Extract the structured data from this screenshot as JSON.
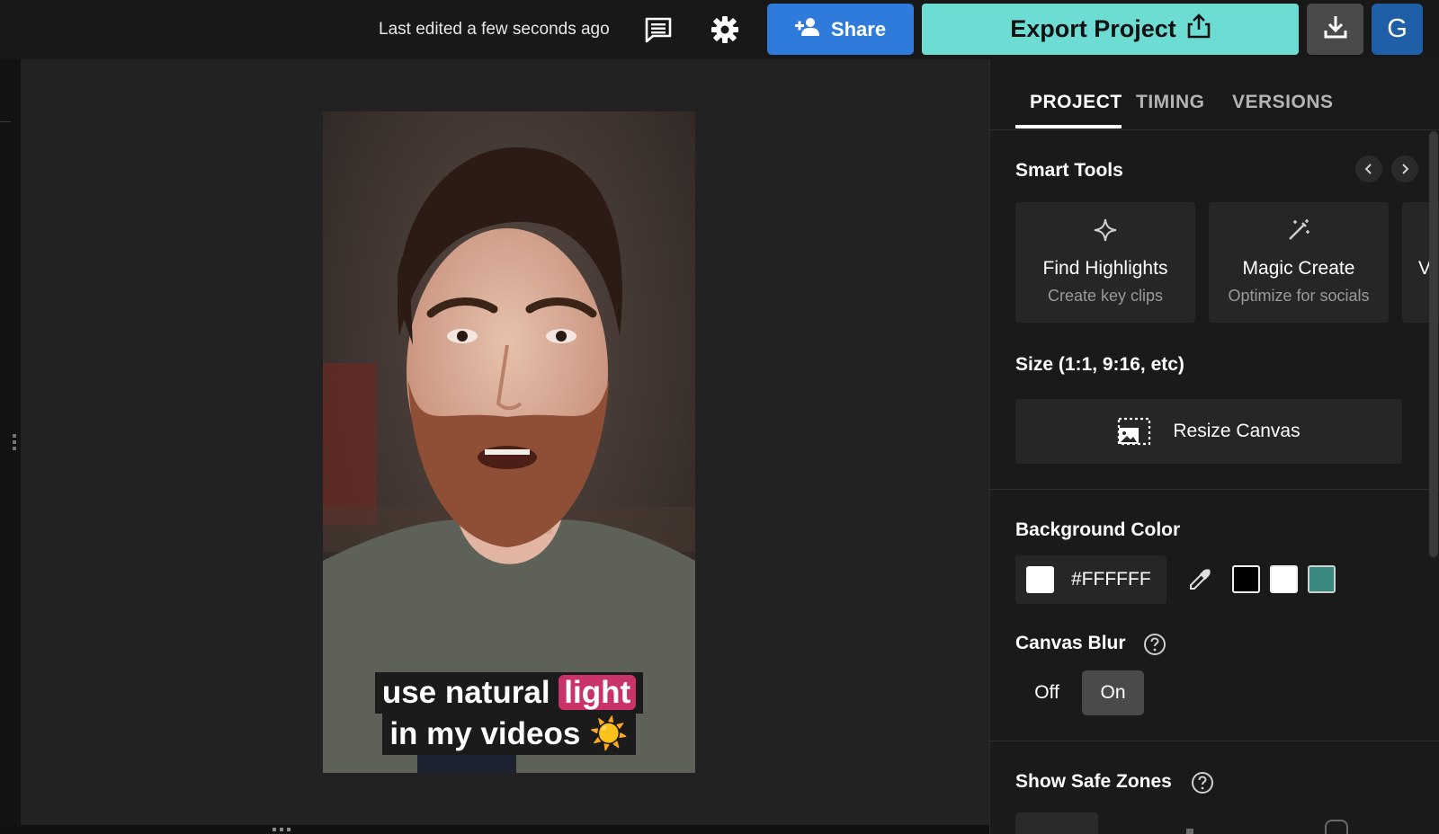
{
  "topbar": {
    "last_edited": "Last edited a few seconds ago",
    "share_label": "Share",
    "export_label": "Export Project",
    "avatar_initial": "G",
    "icons": {
      "comment": "comment-icon",
      "settings": "gear-icon",
      "share": "add-person-icon",
      "export": "share-out-icon",
      "download": "download-icon"
    },
    "colors": {
      "share": "#2e7bdc",
      "export": "#6ddcd3",
      "avatar": "#1f5fa8"
    }
  },
  "preview": {
    "caption": {
      "line1_plain": "use natural",
      "line1_highlight": "light",
      "line2": "in my videos ☀️"
    },
    "highlight_color": "#c8346a"
  },
  "panel": {
    "tabs": [
      {
        "label": "PROJECT",
        "active": true
      },
      {
        "label": "TIMING",
        "active": false
      },
      {
        "label": "VERSIONS",
        "active": false
      }
    ],
    "smart_tools": {
      "title": "Smart Tools",
      "cards": [
        {
          "title": "Find Highlights",
          "subtitle": "Create key clips",
          "icon": "sparkle-icon"
        },
        {
          "title": "Magic Create",
          "subtitle": "Optimize for socials",
          "icon": "magic-wand-icon"
        },
        {
          "title": "V",
          "subtitle": ""
        }
      ]
    },
    "size": {
      "title": "Size (1:1, 9:16, etc)",
      "resize_label": "Resize Canvas",
      "icon": "resize-canvas-icon"
    },
    "background_color": {
      "title": "Background Color",
      "hex": "#FFFFFF",
      "presets": [
        "#000000",
        "#FFFFFF",
        "#3a8a80"
      ]
    },
    "canvas_blur": {
      "title": "Canvas Blur",
      "off_label": "Off",
      "on_label": "On",
      "selected": "On"
    },
    "safe_zones": {
      "title": "Show Safe Zones"
    }
  }
}
